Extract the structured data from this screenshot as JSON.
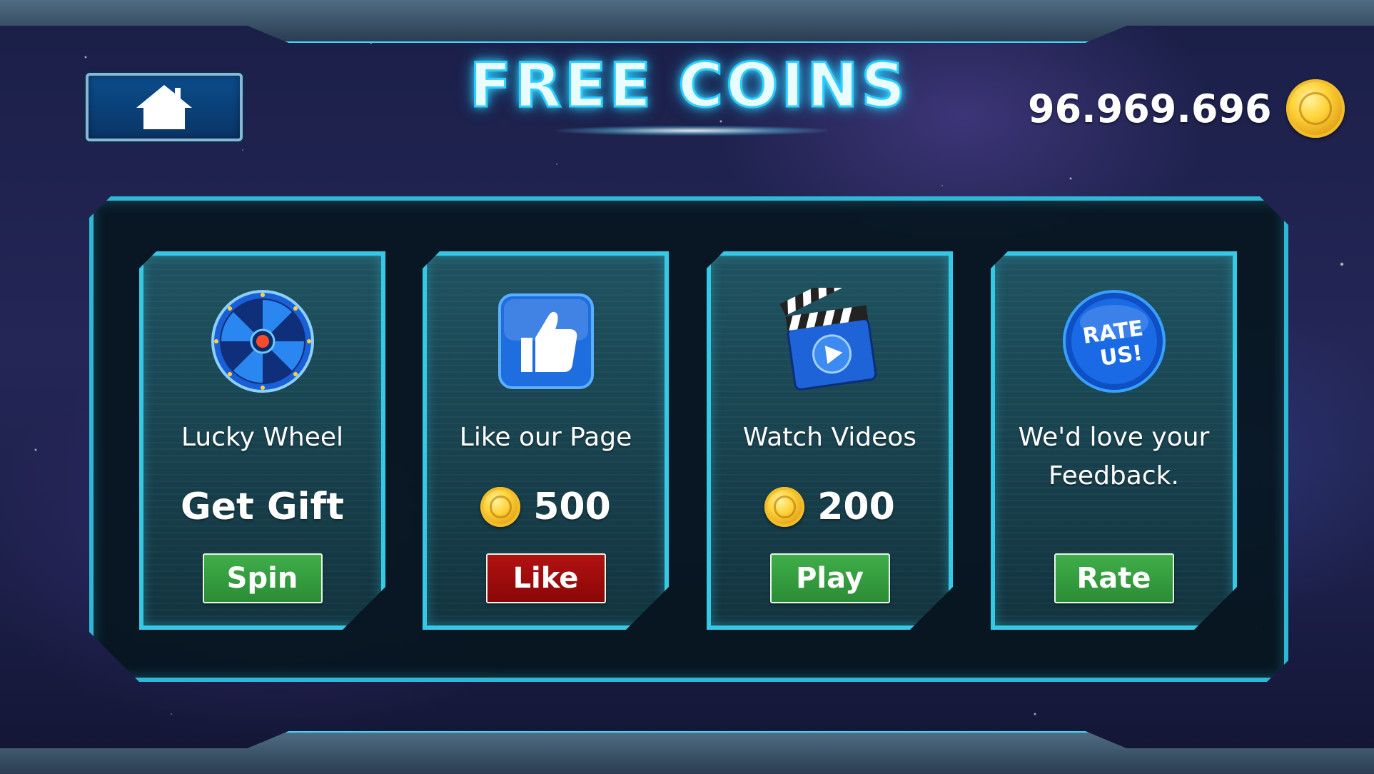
{
  "screen": {
    "title": "FREE COINS",
    "coin_balance": "96.969.696"
  },
  "header": {
    "home_icon": "house-icon",
    "coin_icon": "gold-coin-icon"
  },
  "cards": [
    {
      "title": "Lucky Wheel",
      "reward": "Get Gift",
      "icon": "lucky-wheel-icon",
      "action_label": "Spin",
      "action_color": "#2f9a3b"
    },
    {
      "title": "Like our Page",
      "reward": "500",
      "icon": "thumbs-up-icon",
      "action_label": "Like",
      "action_color": "#a10c0c"
    },
    {
      "title": "Watch Videos",
      "reward": "200",
      "icon": "clapperboard-play-icon",
      "action_label": "Play",
      "action_color": "#2f9a3b"
    },
    {
      "title": "We'd love your Feedback.",
      "reward": "",
      "icon": "rate-us-badge-icon",
      "icon_text_line1": "RATE",
      "icon_text_line2": "US!",
      "action_label": "Rate",
      "action_color": "#2f9a3b"
    }
  ],
  "colors": {
    "accent_cyan": "#36c9e6",
    "panel_dark": "#06161e",
    "card_teal": "#1f5361",
    "coin_gold": "#ffd33a"
  }
}
